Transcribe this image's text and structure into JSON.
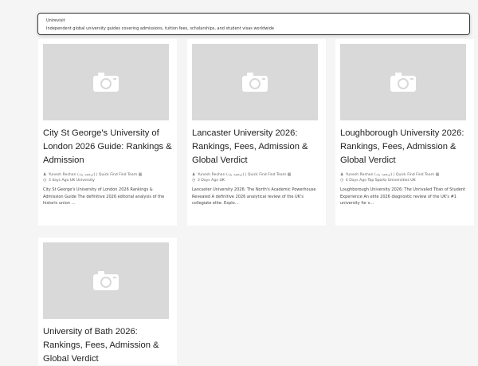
{
  "tooltip": {
    "title": "Unirevisit",
    "description": "Independent global university guides covering admissions, tuition fees, scholarships, and student visas worldwide"
  },
  "cards": [
    {
      "title": "City St George's University of London 2026 Guide: Rankings & Admission",
      "author": "Yunesh Reshan (ترجمہ پتہ) | Quick Find Find Team",
      "date": "3 days Ago",
      "category": "UK University",
      "excerpt": "City St George's University of London 2026 Rankings & Admission Guide The definitive 2026 editorial analysis of the historic union …"
    },
    {
      "title": "Lancaster University 2026: Rankings, Fees, Admission & Global Verdict",
      "author": "Yunesh Reshan (ترجمہ پتہ) | Quick Find Find Team",
      "date": "3 Days Ago",
      "category": "UK",
      "excerpt": "Lancaster University 2026: The North's Academic Powerhouse Revealed A definitive 2026 analytical review of the UK's collegiate elite. Explo…"
    },
    {
      "title": "Loughborough University 2026: Rankings, Fees, Admission & Global Verdict",
      "author": "Yunesh Reshan (ترجمہ پتہ) | Quick Find Find Team",
      "date": "4 Days Ago",
      "category": "Top Sports Universities UK",
      "excerpt": "Loughborough University 2026: The Unrivaled Titan of Student Experience An elite 2026 diagnostic review of the UK's #1 university for s…"
    },
    {
      "title": "University of Bath 2026: Rankings, Fees, Admission & Global Verdict",
      "author": "",
      "date": "",
      "category": "",
      "excerpt": ""
    }
  ],
  "icons": {
    "thumbnail": "camera-placeholder-icon",
    "author": "user-icon",
    "date": "clock-icon",
    "category": "folder-icon"
  },
  "colors": {
    "page_bg": "#f5f5f5",
    "card_bg": "#ffffff",
    "thumb_bg": "#d9d9d9"
  }
}
